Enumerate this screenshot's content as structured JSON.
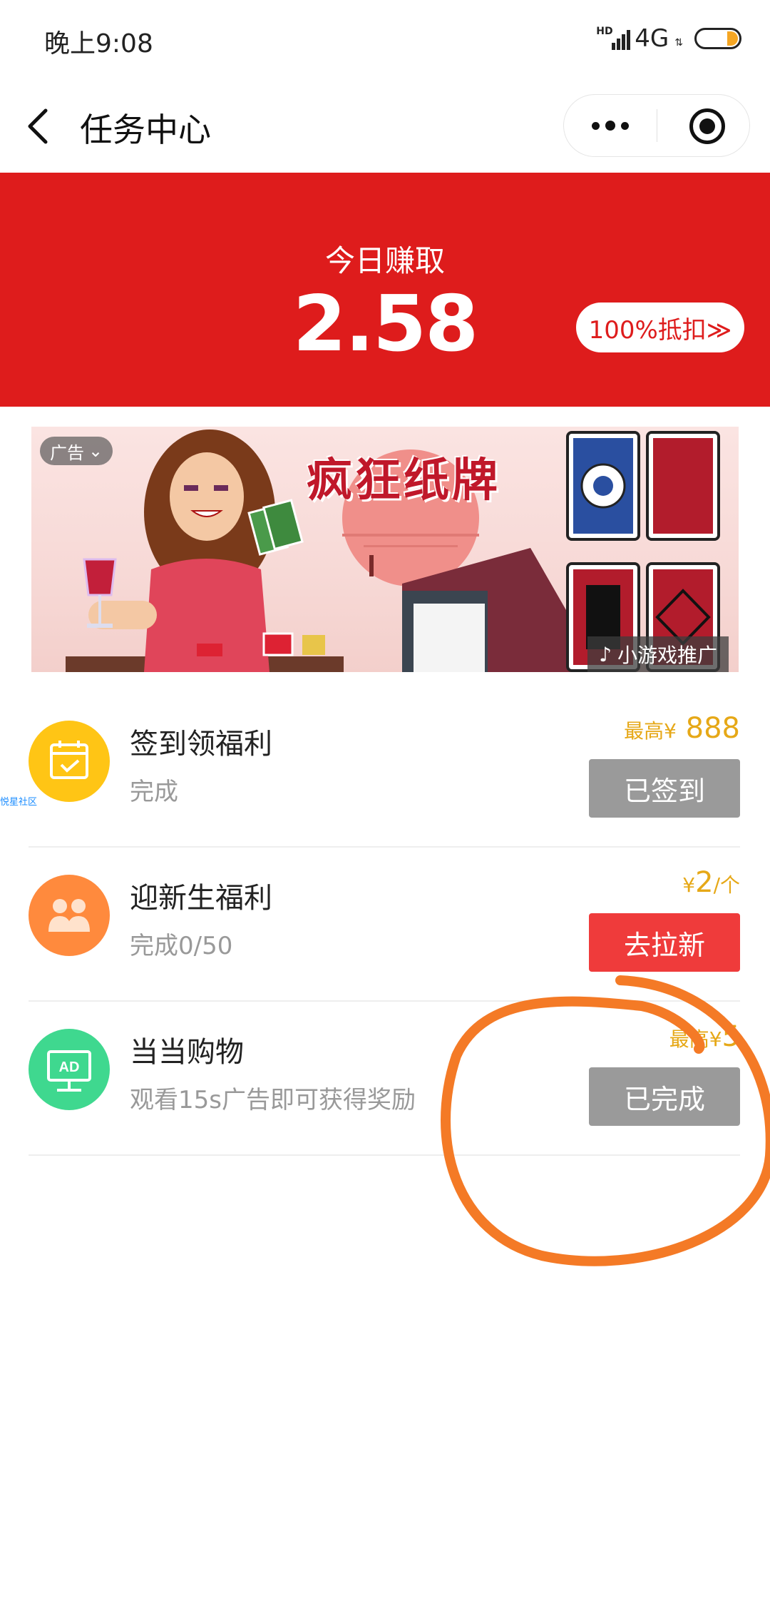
{
  "status_bar": {
    "time": "晚上9:08",
    "hd": "HD",
    "network": "4G",
    "battery_level": 0.25
  },
  "nav": {
    "title": "任务中心",
    "back_icon": "chevron-left-icon",
    "more_icon": "more-dots-icon",
    "close_icon": "target-circle-icon"
  },
  "earnings": {
    "label": "今日赚取",
    "value": "2.58",
    "discount_button": "100%抵扣≫",
    "background": "#de1c1c"
  },
  "ad_banner": {
    "ad_tag": "广告",
    "title": "疯狂纸牌",
    "game_tag": "小游戏推广"
  },
  "watermark": "悦星社区",
  "tasks": [
    {
      "name": "签到领福利",
      "desc": "完成",
      "reward_prefix": "最高¥",
      "reward_value": " 888",
      "button": "已签到",
      "button_state": "done",
      "icon": "calendar-check-icon",
      "icon_color": "#ffc515"
    },
    {
      "name": "迎新生福利",
      "desc": "完成0/50",
      "reward_prefix": "¥",
      "reward_value": "2",
      "reward_suffix": "/个",
      "button": "去拉新",
      "button_state": "active",
      "icon": "invite-users-icon",
      "icon_color": "#ff8a3d"
    },
    {
      "name": "当当购物",
      "desc": "观看15s广告即可获得奖励",
      "reward_prefix": "最高¥",
      "reward_value": "5",
      "button": "已完成",
      "button_state": "done",
      "icon": "ad-board-icon",
      "icon_color": "#3fd88f"
    }
  ],
  "colors": {
    "accent_red": "#de1c1c",
    "reward_gold": "#e6a817",
    "done_gray": "#9a9a9a",
    "annotation_orange": "#f47a26"
  }
}
